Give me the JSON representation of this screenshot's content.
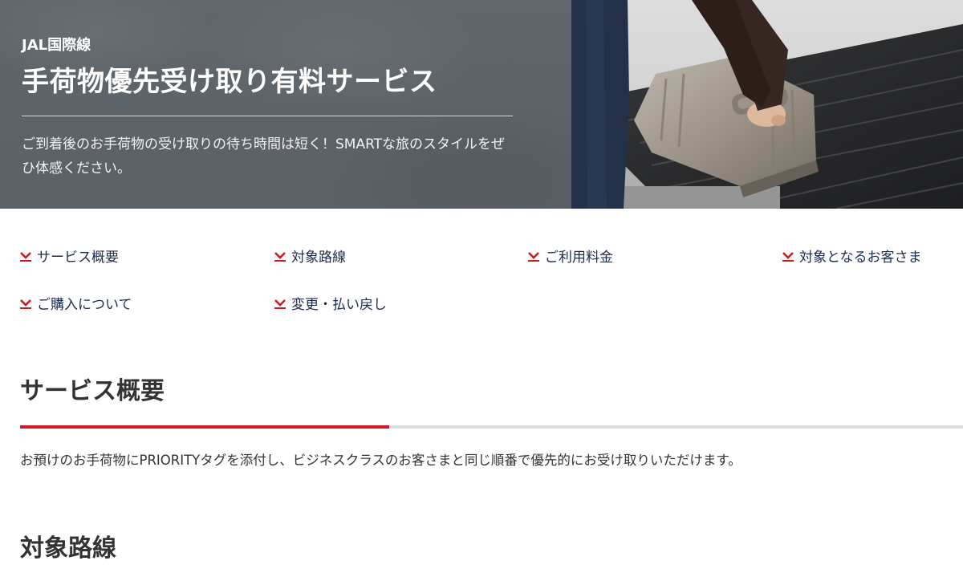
{
  "hero": {
    "kicker": "JAL国際線",
    "title": "手荷物優先受け取り有料サービス",
    "lead": "ご到着後のお手荷物の受け取りの待ち時間は短く！SMARTな旅のスタイルをぜひ体感ください。",
    "photo_icon": "baggage-carousel-photo"
  },
  "anchor_nav": {
    "icon": "chevron-down-icon",
    "accent_color": "#cc1a27",
    "items": [
      {
        "label": "サービス概要"
      },
      {
        "label": "対象路線"
      },
      {
        "label": "ご利用料金"
      },
      {
        "label": "対象となるお客さま"
      },
      {
        "label": "ご購入について"
      },
      {
        "label": "変更・払い戻し"
      }
    ]
  },
  "sections": [
    {
      "title": "サービス概要",
      "body": "お預けのお手荷物にPRIORITYタグを添付し、ビジネスクラスのお客さまと同じ順番で優先的にお受け取りいただけます。"
    },
    {
      "title": "対象路線"
    }
  ],
  "colors": {
    "hero_bg": "#5c6369",
    "link": "#1b2a4e",
    "accent": "#cc1a27",
    "rule": "#dddddd"
  }
}
